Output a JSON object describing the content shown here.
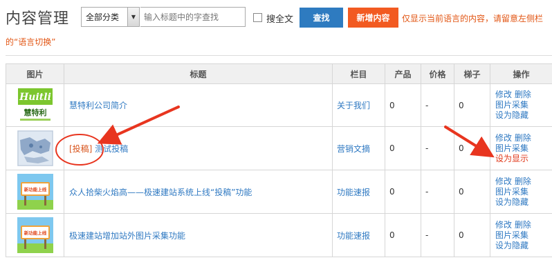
{
  "header": {
    "title": "内容管理",
    "category_select": "全部分类",
    "search_placeholder": "输入标题中的字查找",
    "fulltext_label": "搜全文",
    "search_button": "查找",
    "add_button": "新增内容",
    "notice_line1": "仅显示当前语言的内容，请留意左侧栏",
    "notice_line2": "的“语言切换”"
  },
  "table": {
    "headers": [
      "图片",
      "标题",
      "栏目",
      "产品",
      "价格",
      "梯子",
      "操作"
    ],
    "rows": [
      {
        "thumb": "huitli-logo",
        "logo_cn": "慧特利",
        "tag": "",
        "title": "慧特利公司简介",
        "column": "关于我们",
        "product": "0",
        "price": "-",
        "ladder": "0",
        "op1": "修改",
        "op2": "删除",
        "op3": "图片采集",
        "op4": "设为隐藏"
      },
      {
        "thumb": "blue-map-image",
        "tag": "[投稿]",
        "title": "测试投稿",
        "column": "营销文摘",
        "product": "0",
        "price": "-",
        "ladder": "0",
        "op1": "修改",
        "op2": "删除",
        "op3": "图片采集",
        "op4": "设为显示"
      },
      {
        "thumb": "sign-image",
        "sign_text": "新功能上线",
        "tag": "",
        "title": "众人拾柴火焰高——极速建站系统上线“投稿”功能",
        "column": "功能速报",
        "product": "0",
        "price": "-",
        "ladder": "0",
        "op1": "修改",
        "op2": "删除",
        "op3": "图片采集",
        "op4": "设为隐藏"
      },
      {
        "thumb": "sign-image",
        "sign_text": "新功能上线",
        "tag": "",
        "title": "极速建站增加站外图片采集功能",
        "column": "功能速报",
        "product": "0",
        "price": "-",
        "ladder": "0",
        "op1": "修改",
        "op2": "删除",
        "op3": "图片采集",
        "op4": "设为隐藏"
      }
    ]
  },
  "colors": {
    "accent_blue": "#2e7bc0",
    "accent_orange": "#f25a21",
    "link": "#2f79c2",
    "annotation_red": "#e8351f"
  }
}
